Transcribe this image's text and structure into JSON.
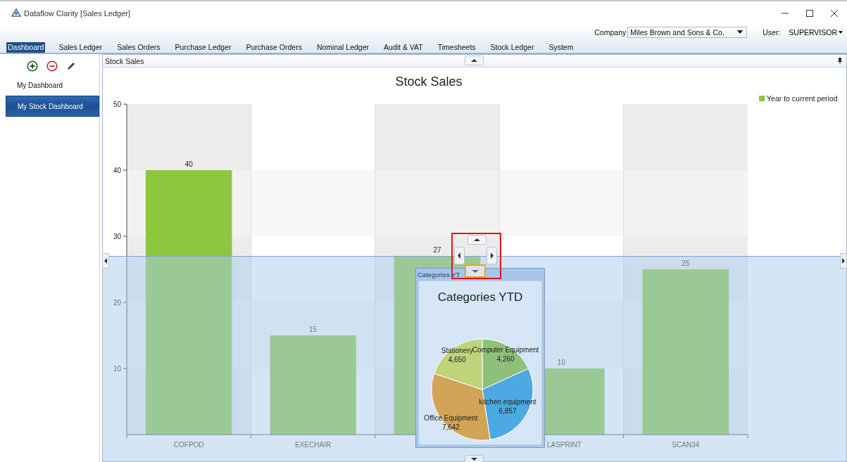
{
  "window": {
    "title": "Dataflow Clarity [Sales Ledger]"
  },
  "company": {
    "label": "Company",
    "value": "Miles Brown and Sons & Co."
  },
  "user": {
    "label": "User:",
    "value": "SUPERVISOR"
  },
  "tabs": [
    {
      "label": "Dashboard",
      "selected": true
    },
    {
      "label": "Sales Ledger",
      "selected": false
    },
    {
      "label": "Sales Orders",
      "selected": false
    },
    {
      "label": "Purchase Ledger",
      "selected": false
    },
    {
      "label": "Purchase Orders",
      "selected": false
    },
    {
      "label": "Nominal Ledger",
      "selected": false
    },
    {
      "label": "Audit & VAT",
      "selected": false
    },
    {
      "label": "Timesheets",
      "selected": false
    },
    {
      "label": "Stock Ledger",
      "selected": false
    },
    {
      "label": "System",
      "selected": false
    }
  ],
  "sidebar": {
    "items": [
      {
        "label": "My Dashboard",
        "selected": false
      },
      {
        "label": "My Stock Dashboard",
        "selected": true
      }
    ]
  },
  "panel": {
    "title": "Stock Sales",
    "chart_data": {
      "type": "bar",
      "title": "Stock Sales",
      "categories": [
        "COFPOD",
        "EXECHAIR",
        null,
        "LASPRINT",
        "SCAN34"
      ],
      "series": [
        {
          "name": "Year to current period",
          "color": "#8dc63f",
          "values": [
            40,
            15,
            27,
            10,
            25
          ]
        }
      ],
      "ylim": [
        0,
        50
      ],
      "yticks": [
        10,
        20,
        30,
        40,
        50
      ],
      "data_labels": true
    }
  },
  "floating_window": {
    "title": "Categories YT",
    "chart_data": {
      "type": "pie",
      "title": "Categories YTD",
      "categories": [
        "Computer Equipment",
        "kitchen equipment",
        "Office Equipment",
        "Stationery"
      ],
      "values": [
        4260,
        6857,
        7642,
        4650
      ],
      "data_labels": true,
      "value_labels": [
        "4,260",
        "6,857",
        "7,642",
        "4,650"
      ]
    }
  }
}
